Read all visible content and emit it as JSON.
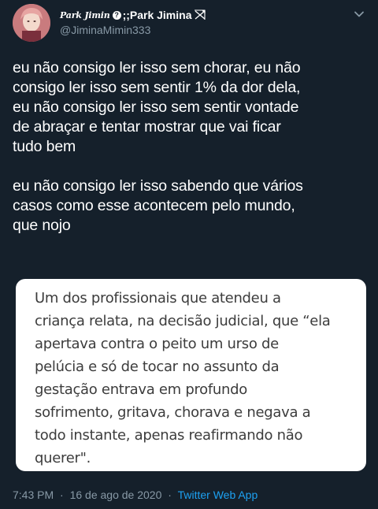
{
  "user": {
    "display_name_script": "Park Jimin",
    "display_name_badge": "?",
    "display_name": ";;Park Jimina",
    "handle": "@JiminaMimin333"
  },
  "tweet": {
    "paragraphs": [
      "eu não consigo ler isso sem chorar, eu não\nconsigo ler isso sem sentir 1% da dor dela,\neu não consigo ler isso sem sentir vontade\nde abraçar e tentar mostrar que vai ficar\ntudo bem",
      "eu não consigo ler isso sabendo que vários\ncasos como esse acontecem pelo mundo,\nque nojo"
    ],
    "quoted_image_text": "Um dos profissionais que atendeu a\ncriança relata, na decisão judicial, que “ela\napertava contra o peito um urso de\npelúcia e só de tocar no assunto da\ngestação entrava em profundo\nsofrimento, gritava, chorava e negava a\ntodo instante, apenas reafirmando não\nquerer\".",
    "time": "7:43 PM",
    "date": "16 de ago de 2020",
    "separator": "·",
    "source": "Twitter Web App"
  },
  "colors": {
    "background": "#15202b",
    "text_primary": "#ffffff",
    "text_secondary": "#8899a6",
    "link": "#1da1f2"
  },
  "icons": {
    "more": "chevron-down-icon",
    "name_decoration": "bow-arrow-icon"
  }
}
